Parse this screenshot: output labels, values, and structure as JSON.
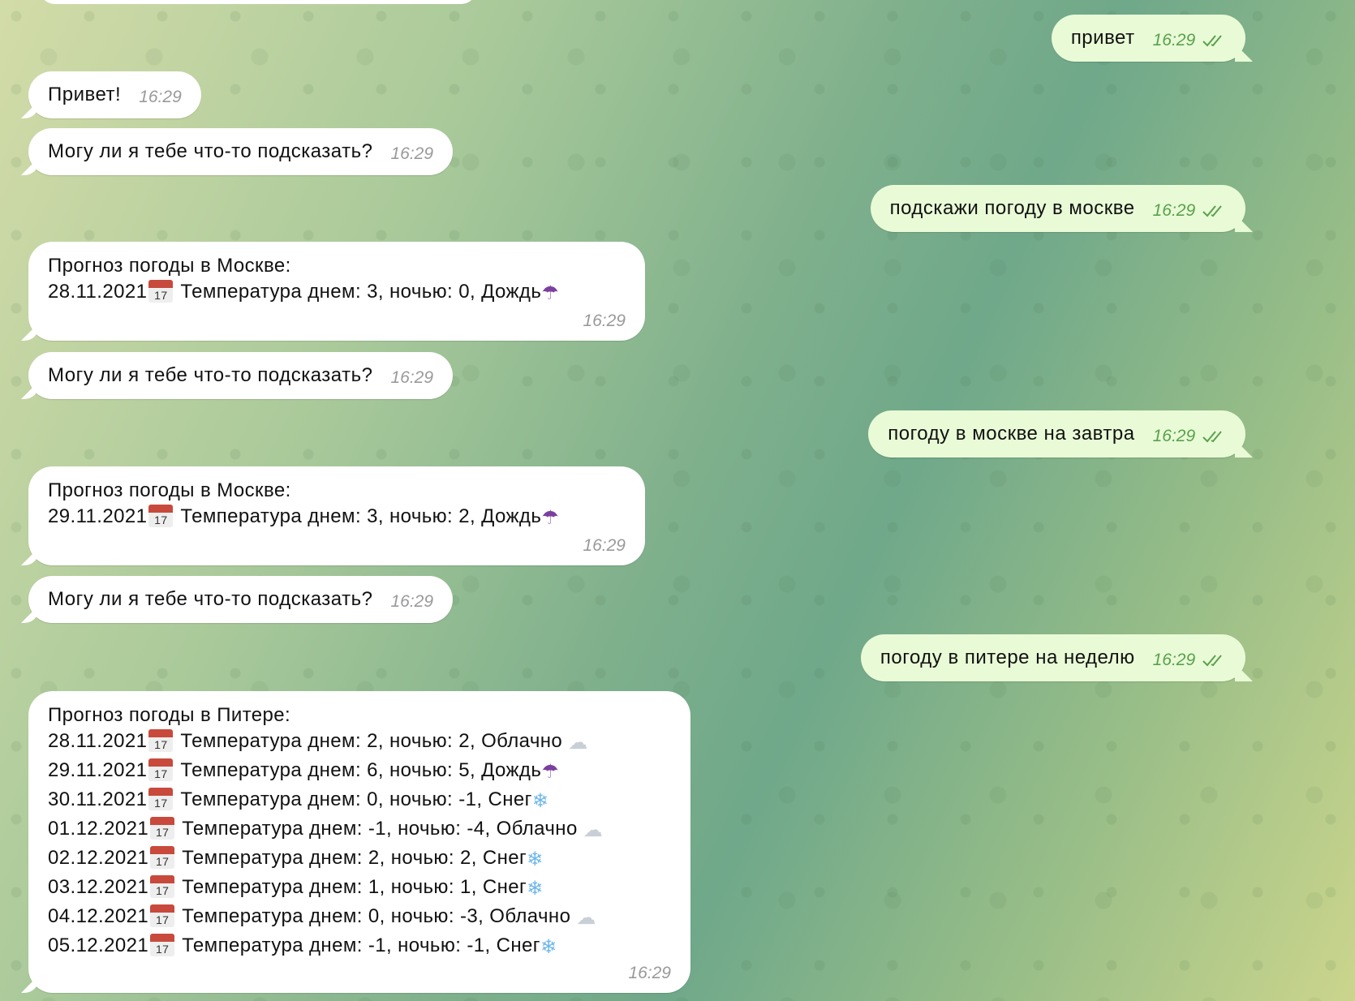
{
  "messages": [
    {
      "dir": "out",
      "text": "привет",
      "time": "16:29"
    },
    {
      "dir": "in",
      "text": "Привет!",
      "time": "16:29"
    },
    {
      "dir": "in",
      "text": "Могу ли я тебе что-то подсказать?",
      "time": "16:29"
    },
    {
      "dir": "out",
      "text": "подскажи погоду в москве",
      "time": "16:29"
    },
    {
      "dir": "in",
      "title": "Прогноз погоды в Москве:",
      "lines": [
        {
          "date": "28.11.2021",
          "cal": "17",
          "text": "Температура днем: 3, ночью: 0, Дождь",
          "icon": "umbrella-icon"
        }
      ],
      "time": "16:29"
    },
    {
      "dir": "in",
      "text": "Могу ли я тебе что-то подсказать?",
      "time": "16:29"
    },
    {
      "dir": "out",
      "text": "погоду в москве на завтра",
      "time": "16:29"
    },
    {
      "dir": "in",
      "title": "Прогноз погоды в Москве:",
      "lines": [
        {
          "date": "29.11.2021",
          "cal": "17",
          "text": "Температура днем: 3, ночью: 2, Дождь",
          "icon": "umbrella-icon"
        }
      ],
      "time": "16:29"
    },
    {
      "dir": "in",
      "text": "Могу ли я тебе что-то подсказать?",
      "time": "16:29"
    },
    {
      "dir": "out",
      "text": "погоду в питере на неделю",
      "time": "16:29"
    },
    {
      "dir": "in",
      "title": "Прогноз погоды в Питере:",
      "lines": [
        {
          "date": "28.11.2021",
          "cal": "17",
          "text": "Температура днем: 2, ночью: 2, Облачно",
          "icon": "cloud-icon"
        },
        {
          "date": "29.11.2021",
          "cal": "17",
          "text": "Температура днем: 6, ночью: 5, Дождь",
          "icon": "umbrella-icon"
        },
        {
          "date": "30.11.2021",
          "cal": "17",
          "text": "Температура днем: 0, ночью: -1, Снег",
          "icon": "snowflake-icon"
        },
        {
          "date": "01.12.2021",
          "cal": "17",
          "text": "Температура днем: -1, ночью: -4, Облачно",
          "icon": "cloud-icon"
        },
        {
          "date": "02.12.2021",
          "cal": "17",
          "text": "Температура днем: 2, ночью: 2, Снег",
          "icon": "snowflake-icon"
        },
        {
          "date": "03.12.2021",
          "cal": "17",
          "text": "Температура днем: 1, ночью: 1, Снег",
          "icon": "snowflake-icon"
        },
        {
          "date": "04.12.2021",
          "cal": "17",
          "text": "Температура днем: 0, ночью: -3, Облачно",
          "icon": "cloud-icon"
        },
        {
          "date": "05.12.2021",
          "cal": "17",
          "text": "Температура днем: -1, ночью: -1, Снег",
          "icon": "snowflake-icon"
        }
      ],
      "time": "16:29"
    }
  ],
  "colors": {
    "incoming": "#ffffff",
    "outgoing": "#e9fbd6",
    "time_out": "#5aa14d",
    "time_in": "#9a9a9a"
  }
}
